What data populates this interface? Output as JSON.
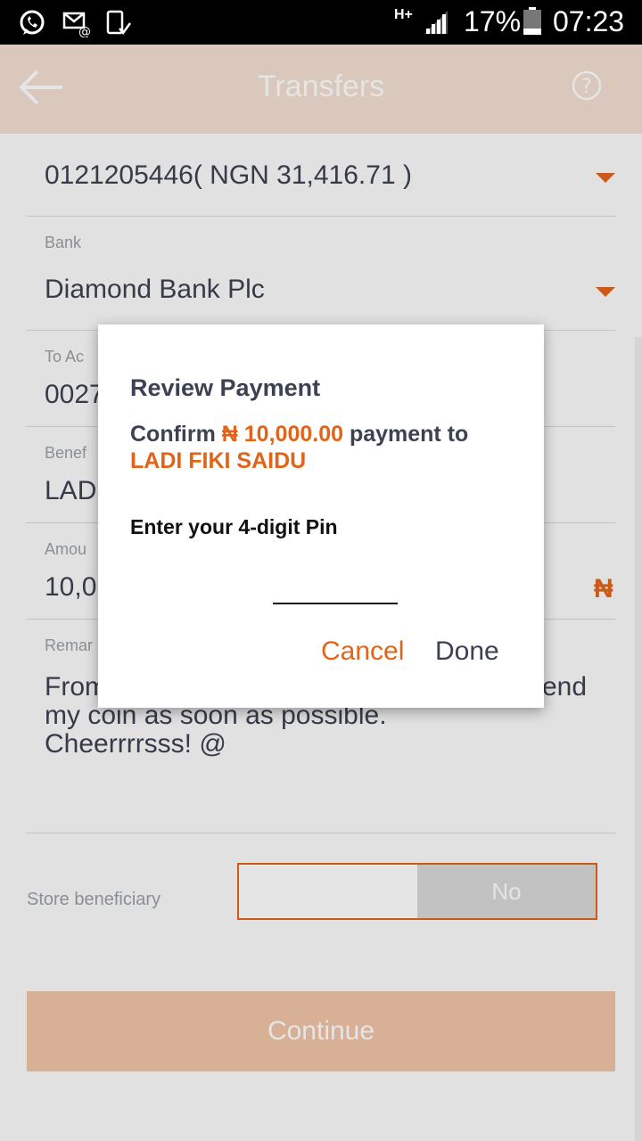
{
  "status_bar": {
    "network": "H+",
    "battery_percent": "17%",
    "time": "07:23",
    "left_icons": [
      "whatsapp-icon",
      "email-notification-icon",
      "phone-check-icon"
    ],
    "right_icons": [
      "signal-icon",
      "battery-icon"
    ]
  },
  "app_bar": {
    "title": "Transfers",
    "back_icon": "arrow-left-icon",
    "help_icon": "help-circle-icon"
  },
  "form": {
    "source_account": "0121205446( NGN 31,416.71 )",
    "bank_label": "Bank",
    "bank_value": "Diamond Bank Plc",
    "to_account_label": "To Ac",
    "to_account_value": "0027",
    "beneficiary_label": "Benef",
    "beneficiary_value": "LAD",
    "amount_label": "Amou",
    "amount_value": "10,0",
    "amount_currency": "₦",
    "remark_label": "Remar",
    "remark_line1_start": "From",
    "remark_line1_end": "end",
    "remark_line2": "my coin as soon as possible.",
    "remark_line3": "Cheerrrrsss! @",
    "store_beneficiary_label": "Store beneficiary",
    "toggle_no": "No",
    "continue_label": "Continue"
  },
  "dialog": {
    "title": "Review Payment",
    "confirm_prefix": "Confirm",
    "amount": "₦ 10,000.00",
    "confirm_suffix": "payment to",
    "recipient": "LADI FIKI SAIDU",
    "pin_label": "Enter your 4-digit Pin",
    "pin_value": "",
    "cancel_label": "Cancel",
    "done_label": "Done"
  },
  "colors": {
    "accent": "#e0651a",
    "app_bar": "#f4dfd2",
    "text_dark": "#3c4251"
  }
}
